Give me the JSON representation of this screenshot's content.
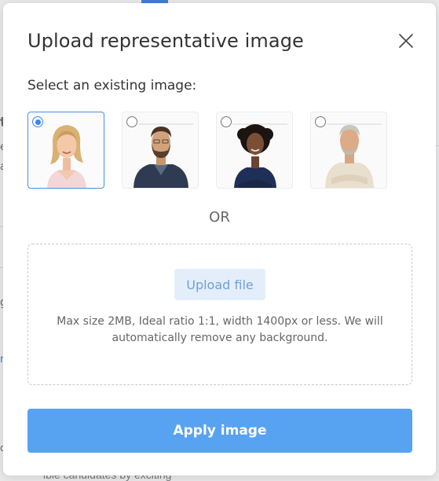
{
  "modal": {
    "title": "Upload representative image",
    "subtitle": "Select an existing image:",
    "or_label": "OR",
    "upload_button_label": "Upload file",
    "upload_hint": "Max size 2MB, Ideal ratio 1:1, width 1400px or less. We will automatically remove any background.",
    "apply_button_label": "Apply image",
    "images": [
      {
        "selected": true,
        "icon": "portrait-woman-blonde"
      },
      {
        "selected": false,
        "icon": "portrait-man-bearded"
      },
      {
        "selected": false,
        "icon": "portrait-woman-curly"
      },
      {
        "selected": false,
        "icon": "portrait-man-gray"
      }
    ]
  },
  "background": {
    "partial_text": "ible candidates by exciting",
    "fragments": [
      "t",
      "e",
      "a",
      "g",
      "n",
      "ot"
    ]
  },
  "colors": {
    "accent": "#58a2f2",
    "selected_border": "#4a90e2",
    "upload_button_bg": "#e4eefb",
    "upload_button_text": "#6f9fdb"
  }
}
